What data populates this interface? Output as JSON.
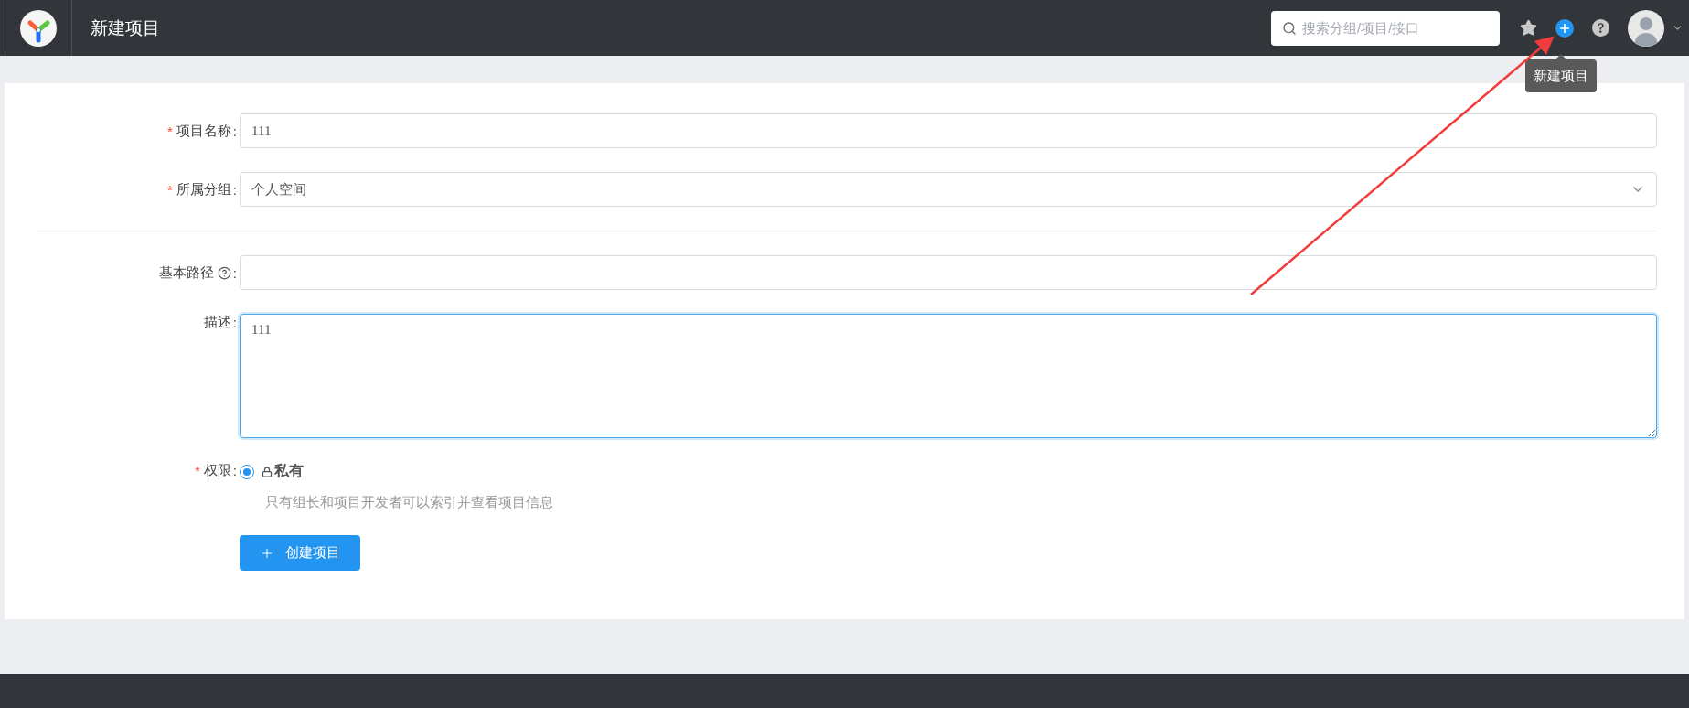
{
  "header": {
    "title": "新建项目",
    "search": {
      "placeholder": "搜索分组/项目/接口"
    },
    "tooltip": "新建项目"
  },
  "form": {
    "fields": [
      {
        "kind": "input",
        "mark": "*",
        "label": "项目名称",
        "colon": ":",
        "value": "111"
      },
      {
        "kind": "select",
        "mark": "*",
        "label": "所属分组",
        "colon": ":",
        "value": "个人空间"
      },
      {
        "kind": "divider"
      },
      {
        "kind": "input",
        "label": "基本路径",
        "help": true,
        "colon": ":"
      },
      {
        "kind": "textarea",
        "label": "描述",
        "colon": ":",
        "value": "111",
        "focused": true
      },
      {
        "kind": "radio",
        "mark": "*",
        "label": "权限",
        "colon": ":",
        "options": [
          {
            "label": "私有",
            "selected": true,
            "hint": "只有组长和项目开发者可以索引并查看项目信息"
          }
        ]
      }
    ],
    "submit": "创建项目"
  }
}
